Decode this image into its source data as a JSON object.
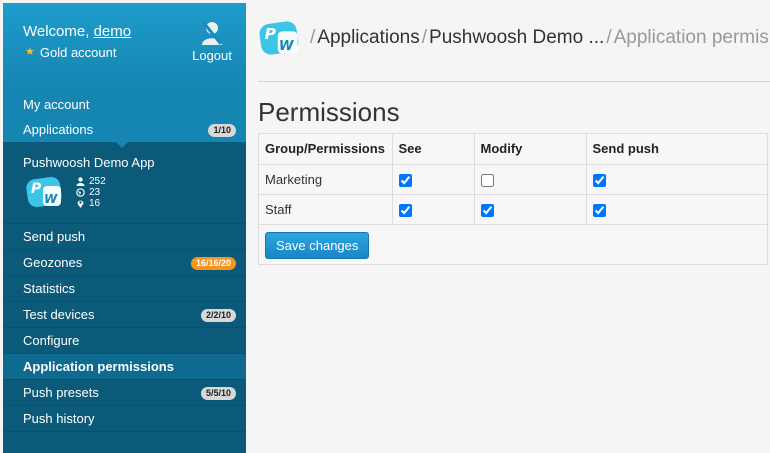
{
  "header": {
    "welcome_prefix": "Welcome,",
    "username": "demo",
    "account_type": "Gold account",
    "logout_label": "Logout"
  },
  "nav_top": [
    {
      "label": "My account"
    },
    {
      "label": "Applications",
      "badge": "1/10"
    }
  ],
  "app": {
    "name": "Pushwoosh Demo App",
    "logo_text": [
      "P",
      "W"
    ],
    "stats": {
      "users": "252",
      "globe": "23",
      "pins": "16"
    }
  },
  "menu": [
    {
      "label": "Send push"
    },
    {
      "label": "Geozones",
      "badge": "16/16/20"
    },
    {
      "label": "Statistics"
    },
    {
      "label": "Test devices",
      "badge": "2/2/10"
    },
    {
      "label": "Configure"
    },
    {
      "label": "Application permissions",
      "selected": true
    },
    {
      "label": "Push presets",
      "badge": "5/5/10"
    },
    {
      "label": "Push history"
    }
  ],
  "breadcrumb": {
    "items": [
      "Applications",
      "Pushwoosh Demo ...",
      "Application permis..."
    ],
    "separator": "/"
  },
  "page": {
    "title": "Permissions",
    "save_label": "Save changes"
  },
  "permissions_table": {
    "columns": [
      "Group/Permissions",
      "See",
      "Modify",
      "Send push"
    ],
    "rows": [
      {
        "group": "Marketing",
        "see": true,
        "modify": false,
        "send_push": true
      },
      {
        "group": "Staff",
        "see": true,
        "modify": true,
        "send_push": true
      }
    ]
  },
  "colors": {
    "sidebar": "#0b5a7a",
    "header": "#1e9ccc",
    "accent": "#1a85c6",
    "badge_orange": "#f7941d"
  }
}
